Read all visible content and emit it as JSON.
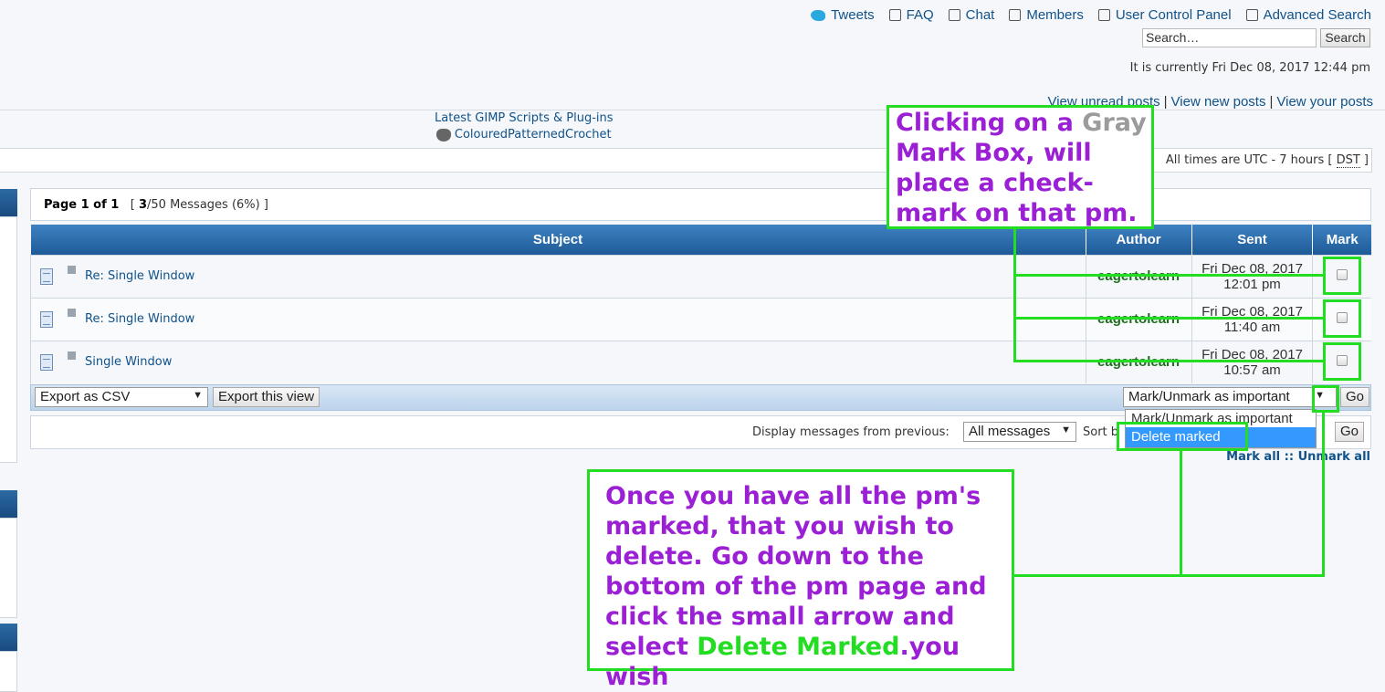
{
  "nav": {
    "items": [
      {
        "label": "Tweets",
        "icon": "twitter-icon"
      },
      {
        "label": "FAQ",
        "icon": "faq-icon"
      },
      {
        "label": "Chat",
        "icon": "chat-icon"
      },
      {
        "label": "Members",
        "icon": "members-icon"
      },
      {
        "label": "User Control Panel",
        "icon": "user-control-panel-icon"
      },
      {
        "label": "Advanced Search",
        "icon": "advanced-search-icon"
      }
    ]
  },
  "search": {
    "placeholder": "Search…",
    "button": "Search"
  },
  "currently": "It is currently Fri Dec 08, 2017 12:44 pm",
  "quicklinks": {
    "unread": "View unread posts",
    "new": "View new posts",
    "yours": "View your posts",
    "sep": "|"
  },
  "latest": {
    "title": "Latest GIMP Scripts & Plug-ins",
    "item": "ColouredPatternedCrochet"
  },
  "times": {
    "prefix": "All times are UTC - 7 hours [",
    "dst": "DST",
    "suffix": "]"
  },
  "pagination": {
    "page": "Page 1 of 1",
    "count_open": "[",
    "count": "3",
    "count_rest": "/50 Messages (6%)",
    "count_close": "]"
  },
  "table": {
    "headers": {
      "subject": "Subject",
      "author": "Author",
      "sent": "Sent",
      "mark": "Mark"
    },
    "rows": [
      {
        "subject": "Re: Single Window",
        "author": "eagertolearn",
        "sent_date": "Fri Dec 08, 2017",
        "sent_time": "12:01 pm"
      },
      {
        "subject": "Re: Single Window",
        "author": "eagertolearn",
        "sent_date": "Fri Dec 08, 2017",
        "sent_time": "11:40 am"
      },
      {
        "subject": "Single Window",
        "author": "eagertolearn",
        "sent_date": "Fri Dec 08, 2017",
        "sent_time": "10:57 am"
      }
    ]
  },
  "export": {
    "format": "Export as CSV",
    "button": "Export this view"
  },
  "action": {
    "selected": "Mark/Unmark as important",
    "go": "Go",
    "options": [
      "Mark/Unmark as important",
      "Delete marked"
    ]
  },
  "display": {
    "label": "Display messages from previous:",
    "value": "All messages",
    "sort": "Sort b",
    "go": "Go"
  },
  "markall": {
    "mark": "Mark all",
    "sep": "::",
    "unmark": "Unmark all"
  },
  "annotations": {
    "note1": {
      "p1": "Clicking on a ",
      "gray": "Gray",
      "p2": " Mark Box, will place a check-mark on that pm."
    },
    "note2": {
      "p1": "Once you have all the pm's marked, that you wish to delete. Go down to the bottom of the pm page and click the small arrow and select ",
      "green": "Delete Marked",
      "p2": ".you wish"
    }
  },
  "colors": {
    "link": "#105289",
    "header": "#2c6aa4",
    "annotation_border": "#22dd22",
    "annotation_text": "#9b1fd4",
    "author": "#1f6e1f"
  }
}
